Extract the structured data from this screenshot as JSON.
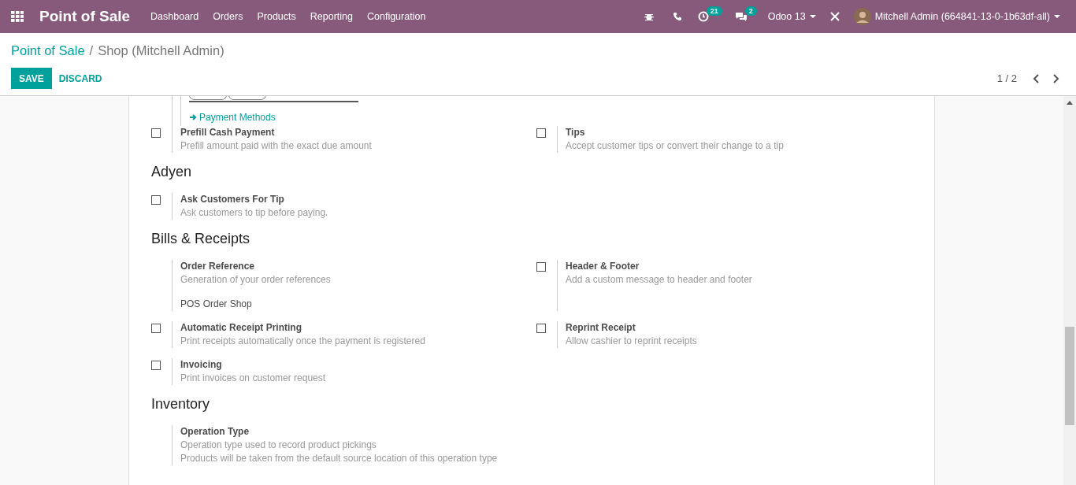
{
  "navbar": {
    "app_title": "Point of Sale",
    "menu": [
      {
        "label": "Dashboard"
      },
      {
        "label": "Orders"
      },
      {
        "label": "Products"
      },
      {
        "label": "Reporting"
      },
      {
        "label": "Configuration"
      }
    ],
    "activity_count": "21",
    "message_count": "2",
    "database": "Odoo 13",
    "user": "Mitchell Admin (664841-13-0-1b63df-all)"
  },
  "breadcrumb": [
    {
      "label": "Point of Sale",
      "kind": "link"
    },
    {
      "label": "Shop (Mitchell Admin)",
      "kind": "current"
    }
  ],
  "breadcrumb_separator": "/",
  "buttons": {
    "save": "SAVE",
    "discard": "DISCARD"
  },
  "pager": "1 / 2",
  "payment_methods_link": "Payment Methods",
  "sections": [
    {
      "rows": [
        [
          {
            "kind": "checkbox",
            "checked": false,
            "title": "Prefill Cash Payment",
            "description": "Prefill amount paid with the exact due amount"
          },
          {
            "kind": "checkbox",
            "checked": false,
            "title": "Tips",
            "description": "Accept customer tips or convert their change to a tip"
          }
        ]
      ]
    },
    {
      "title": "Adyen",
      "rows": [
        [
          {
            "kind": "checkbox",
            "checked": false,
            "title": "Ask Customers For Tip",
            "description": "Ask customers to tip before paying."
          }
        ]
      ]
    },
    {
      "title": "Bills & Receipts",
      "rows": [
        [
          {
            "kind": "plain",
            "title": "Order Reference",
            "description": "Generation of your order references",
            "value": "POS Order Shop"
          },
          {
            "kind": "checkbox",
            "checked": false,
            "title": "Header & Footer",
            "description": "Add a custom message to header and footer"
          }
        ],
        [
          {
            "kind": "checkbox",
            "checked": false,
            "title": "Automatic Receipt Printing",
            "description": "Print receipts automatically once the payment is registered"
          },
          {
            "kind": "checkbox",
            "checked": false,
            "title": "Reprint Receipt",
            "description": "Allow cashier to reprint receipts"
          }
        ],
        [
          {
            "kind": "checkbox",
            "checked": false,
            "title": "Invoicing",
            "description": "Print invoices on customer request"
          }
        ]
      ]
    },
    {
      "title": "Inventory",
      "rows": [
        [
          {
            "kind": "plain",
            "title": "Operation Type",
            "description": "Operation type used to record product pickings",
            "note": "Products will be taken from the default source location of this operation type"
          }
        ]
      ]
    }
  ]
}
